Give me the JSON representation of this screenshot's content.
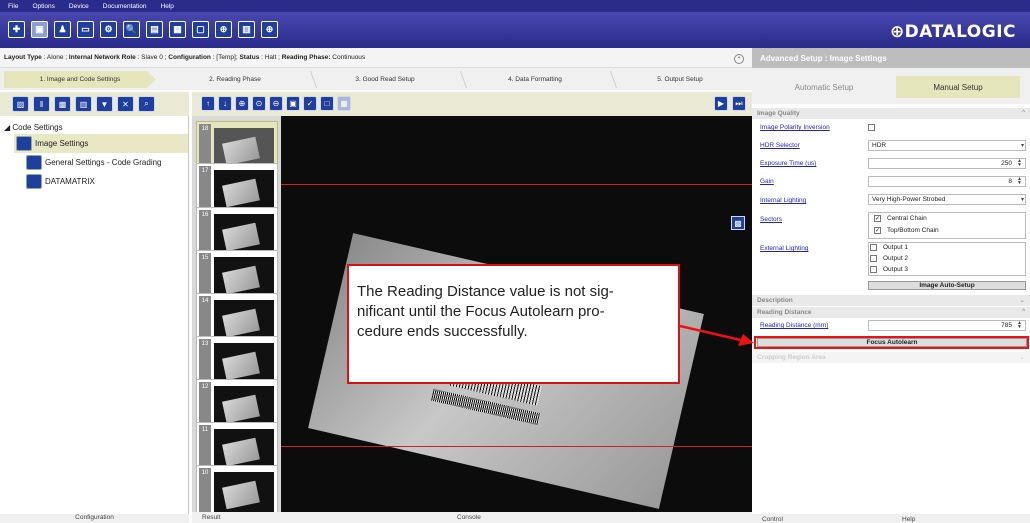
{
  "menu": [
    "File",
    "Options",
    "Device",
    "Documentation",
    "Help"
  ],
  "toolbar": {
    "icons": [
      "plus-icon",
      "device-icon",
      "person-icon",
      "monitor-icon",
      "tool-icon",
      "search-icon",
      "layout-icon",
      "calendar-icon",
      "zoom-icon",
      "chart-icon",
      "network-icon"
    ],
    "logo": "⊕DATALOGIC"
  },
  "layout": {
    "type_label": "Layout Type",
    "type_value": " : Alone ; ",
    "role_label": "Internal Network Role",
    "role_value": " : Slave 0 ; ",
    "config_label": "Configuration",
    "config_value": " : [Temp]; ",
    "status_label": "Status",
    "status_value": " : Halt ; ",
    "phase_label": "Reading Phase:",
    "phase_value": " Continuous"
  },
  "steps": [
    "1. Image and Code Settings",
    "2. Reading Phase",
    "3. Good Read Setup",
    "4. Data Formatting",
    "5. Output Setup"
  ],
  "tree": {
    "root": "◢ Code Settings",
    "image_settings": "Image Settings",
    "general": "General Settings - Code Grading",
    "datamatrix": "DATAMATRIX"
  },
  "left_footer": "Configuration",
  "thumbs": [
    "18",
    "17",
    "16",
    "15",
    "14",
    "13",
    "12",
    "11",
    "10"
  ],
  "center_footer": {
    "result": "Result",
    "console": "Console"
  },
  "callout": "The Reading Distance value is not significant until the Focus Autolearn procedure ends successfully.",
  "callout_lines": [
    "The Reading Distance value is not sig-",
    "nificant until the Focus Autolearn pro-",
    "cedure ends successfully."
  ],
  "right": {
    "header": "Advanced Setup : Image Settings",
    "automatic": "Automatic Setup",
    "manual": "Manual Setup",
    "image_quality": "Image Quality",
    "polarity": "Image Polarity Inversion",
    "hdr": "HDR Selector",
    "hdr_value": "HDR",
    "exposure": "Exposure Time (us)",
    "exposure_value": "250",
    "gain": "Gain",
    "gain_value": "8",
    "lighting": "Internal Lighting",
    "lighting_value": "Very High-Power Strobed",
    "sectors": "Sectors",
    "sector1": "Central Chain",
    "sector2": "Top/Bottom Chain",
    "external": "External Lighting",
    "out1": "Output 1",
    "out2": "Output 2",
    "out3": "Output 3",
    "auto_setup": "Image Auto-Setup",
    "description": "Description",
    "reading_distance_sect": "Reading Distance",
    "reading_distance": "Reading Distance (mm)",
    "reading_distance_value": "785",
    "focus": "Focus Autolearn",
    "cropping": "Cropping Region Area",
    "footer_control": "Control",
    "footer_help": "Help"
  }
}
